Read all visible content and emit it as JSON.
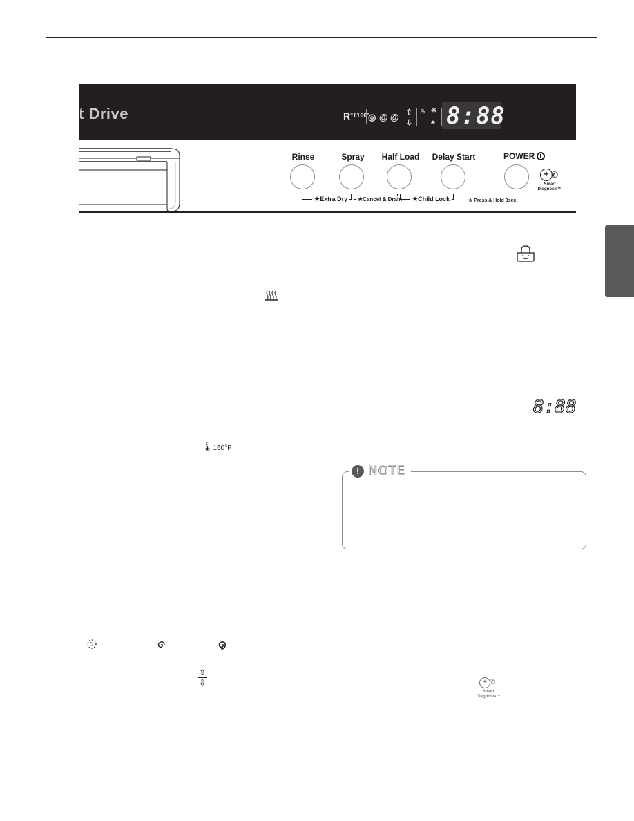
{
  "panel": {
    "brand_text": "t Drive",
    "indicators": {
      "rinse_refill": "R",
      "sanitize": "160°",
      "spray_icons": [
        "light-spray",
        "medium-spray",
        "strong-spray"
      ],
      "arrows": [
        "up",
        "down"
      ],
      "status_icons": [
        "extra-dry",
        "high-temp",
        "child-lock"
      ]
    },
    "display_value": "8:88"
  },
  "buttons": [
    {
      "label": "Rinse"
    },
    {
      "label": "Spray"
    },
    {
      "label": "Half Load"
    },
    {
      "label": "Delay Start"
    },
    {
      "label": "POWER"
    }
  ],
  "hold_functions": [
    {
      "label": "★Extra Dry"
    },
    {
      "label": "★Cancel & Drain"
    },
    {
      "label": "★Child Lock"
    }
  ],
  "press_hold_note": "★ Press & Hold 3sec.",
  "smart_diagnosis": {
    "line1": "Smart",
    "line2": "Diagnosis™"
  },
  "inline_icons": {
    "sanitize_temp": "160°F",
    "display_sample": "8:88"
  },
  "note": {
    "title": "NOTE",
    "icon": "!"
  }
}
